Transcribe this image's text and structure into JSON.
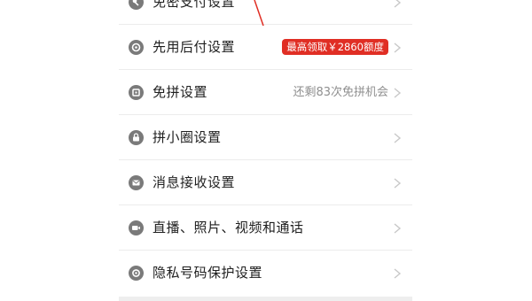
{
  "settings": {
    "items": [
      {
        "label": "免密支付设置",
        "value": "",
        "icon": "key-icon"
      },
      {
        "label": "先用后付设置",
        "value": "",
        "badge": "最高领取￥2860额度",
        "icon": "gear-circle-icon"
      },
      {
        "label": "免拼设置",
        "value": "还剩83次免拼机会",
        "icon": "coupon-icon"
      },
      {
        "label": "拼小圈设置",
        "value": "",
        "icon": "lock-icon"
      },
      {
        "label": "消息接收设置",
        "value": "",
        "icon": "mail-icon"
      },
      {
        "label": "直播、照片、视频和通话",
        "value": "",
        "icon": "video-icon"
      },
      {
        "label": "隐私号码保护设置",
        "value": "",
        "icon": "privacy-shield-icon"
      }
    ]
  },
  "colors": {
    "accent_red": "#e02e24",
    "icon_gray": "#7a7a7a",
    "chevron": "#c8c8c8"
  }
}
